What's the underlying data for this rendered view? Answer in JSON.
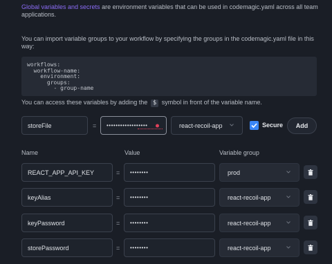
{
  "intro": {
    "link_text": "Global variables and secrets",
    "text_after_link": " are environment variables that can be used in codemagic.yaml across all team applications."
  },
  "import_note": "You can import variable groups to your workflow by specifying the groups in the codemagic.yaml file in this way:",
  "code_snippet": "workflows:\n  workflow-name:\n    environment:\n      groups:\n        - group-name",
  "access_note": {
    "before": "You can access these variables by adding the",
    "symbol": "$",
    "after": "symbol in front of the variable name."
  },
  "new_variable": {
    "name": "storeFile",
    "equals": "=",
    "value_masked": "••••••••••••••••••",
    "group": "react-recoil-app",
    "secure_label": "Secure",
    "secure_checked": true,
    "add_label": "Add"
  },
  "table": {
    "headers": {
      "name": "Name",
      "value": "Value",
      "group": "Variable group"
    },
    "rows": [
      {
        "name": "REACT_APP_API_KEY",
        "equals": "=",
        "value": "••••••••",
        "group": "prod"
      },
      {
        "name": "keyAlias",
        "equals": "=",
        "value": "••••••••",
        "group": "react-recoil-app"
      },
      {
        "name": "keyPassword",
        "equals": "=",
        "value": "••••••••",
        "group": "react-recoil-app"
      },
      {
        "name": "storePassword",
        "equals": "=",
        "value": "••••••••",
        "group": "react-recoil-app"
      }
    ]
  },
  "colors": {
    "link": "#8b6cf5",
    "checkbox": "#3a86f6",
    "error_dot": "#e0405a",
    "background": "#1a1e26"
  },
  "icons": {
    "dropdown": "chevron-down-icon",
    "delete": "trash-icon",
    "check": "check-icon"
  }
}
